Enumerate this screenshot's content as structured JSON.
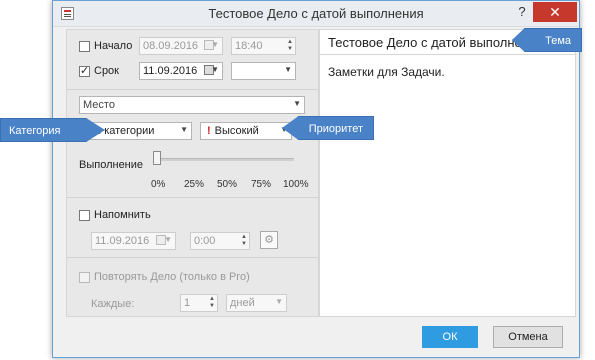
{
  "window": {
    "title": "Тестовое Дело с датой выполнения",
    "help_label": "?",
    "close_label": "✕"
  },
  "schedule": {
    "start_label": "Начало",
    "start_checked": false,
    "start_date": "08.09.2016",
    "start_time": "18:40",
    "due_label": "Срок",
    "due_checked": true,
    "due_date": "11.09.2016",
    "due_time": ""
  },
  "location": {
    "placeholder": "Место"
  },
  "category": {
    "value": "Без категории"
  },
  "priority": {
    "icon": "!",
    "value": "Высокий"
  },
  "progress": {
    "label": "Выполнение",
    "value_percent": 0,
    "ticks": [
      "0%",
      "25%",
      "50%",
      "75%",
      "100%"
    ]
  },
  "reminder": {
    "label": "Напомнить",
    "checked": false,
    "date": "11.09.2016",
    "time": "0:00"
  },
  "repeat": {
    "label": "Повторять Дело (только в Pro)",
    "every_label": "Каждые:",
    "count": "1",
    "unit": "дней"
  },
  "subject": "Тестовое Дело с датой выполнения",
  "notes": "Заметки для Задачи.",
  "buttons": {
    "ok": "ОК",
    "cancel": "Отмена"
  },
  "callouts": {
    "category": "Категория",
    "priority": "Приоритет",
    "subject": "Тема"
  },
  "colors": {
    "accent": "#2f9be0",
    "callout": "#4a82c8",
    "close": "#c7382c",
    "priority_icon": "#d32020"
  }
}
